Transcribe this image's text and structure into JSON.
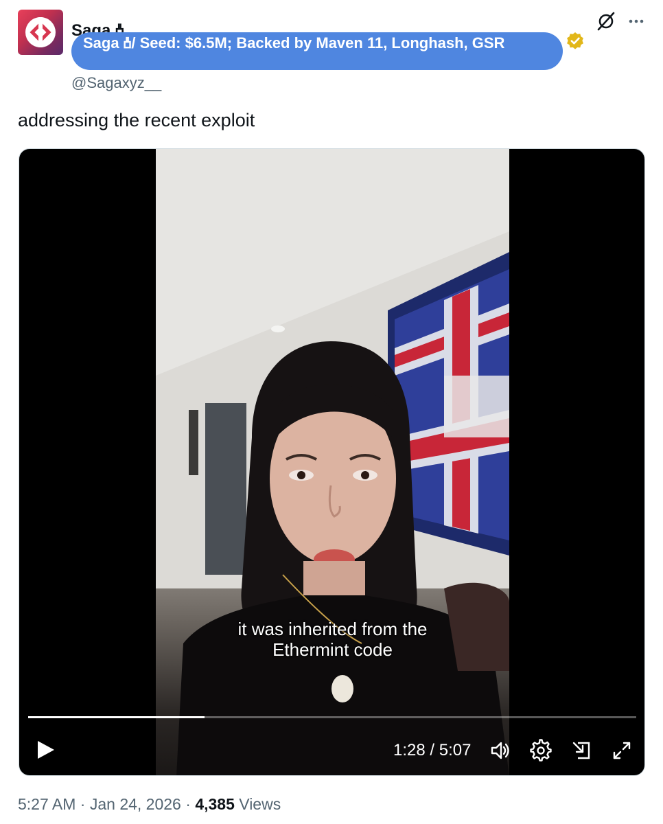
{
  "author": {
    "display_name": "Saga 🝅",
    "affiliation": "Saga 🝅/ Seed: $6.5M; Backed by Maven 11, Longhash, GSR",
    "handle": "@Sagaxyz__"
  },
  "icons": {
    "avatar": "saga-logo",
    "verified": "gold-verified-badge-icon",
    "grok": "grok-icon",
    "more": "more-icon"
  },
  "tweet": {
    "text": "addressing the recent exploit"
  },
  "video": {
    "caption_line1": "it was inherited from the",
    "caption_line2": "Ethermint code",
    "time": "1:28 / 5:07",
    "progress": 0.29,
    "controls": [
      "play-icon",
      "volume-icon",
      "settings-icon",
      "pop-out-icon",
      "fullscreen-icon"
    ]
  },
  "footer": {
    "time": "5:27 AM",
    "separator1": " · ",
    "date": "Jan 24, 2026",
    "separator2": " · ",
    "views_count": "4,385",
    "views_label": " Views"
  },
  "colors": {
    "affiliation_bg": "#4f86e0",
    "verified_gold": "#e2b719",
    "secondary_text": "#536471"
  }
}
